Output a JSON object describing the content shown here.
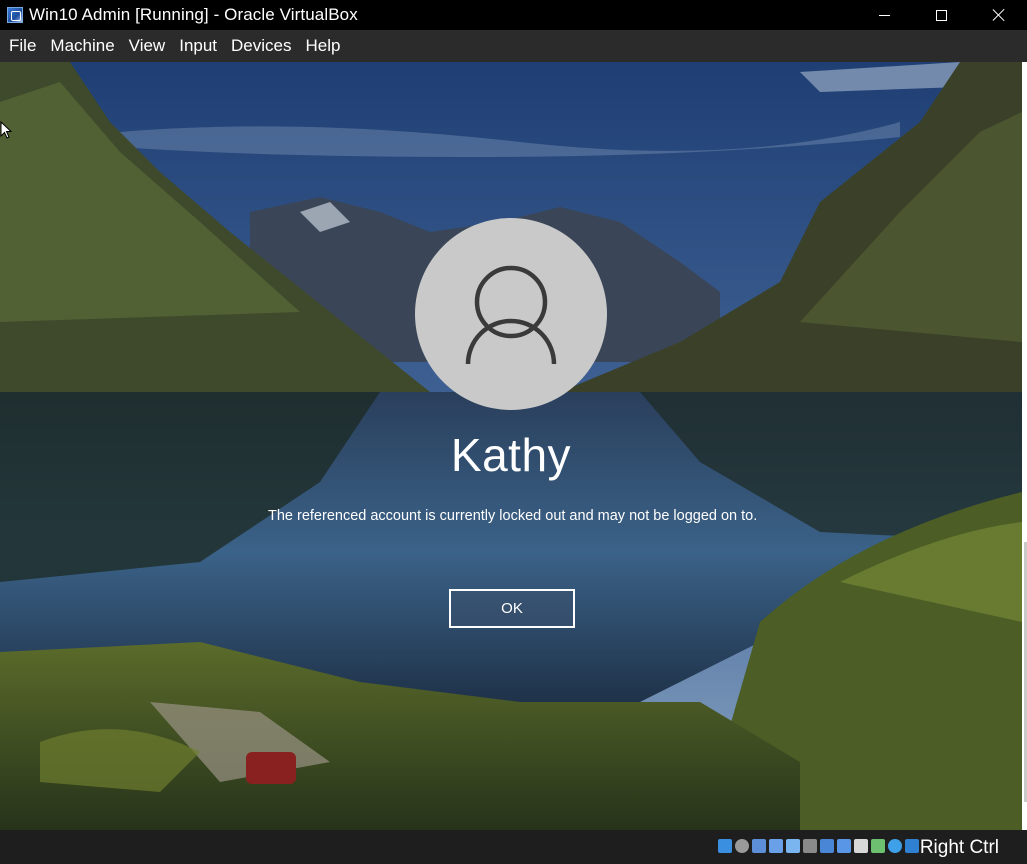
{
  "window": {
    "title": "Win10 Admin [Running] - Oracle VirtualBox",
    "minimize_icon": "minimize-icon",
    "maximize_icon": "maximize-icon",
    "close_icon": "close-icon"
  },
  "menubar": {
    "items": [
      "File",
      "Machine",
      "View",
      "Input",
      "Devices",
      "Help"
    ]
  },
  "lockscreen": {
    "username": "Kathy",
    "message": "The referenced account is currently locked out and may not be logged on to.",
    "ok_label": "OK",
    "avatar_icon": "user-avatar-icon"
  },
  "statusbar": {
    "host_key_label": "Right Ctrl",
    "icons": [
      "hard-disk-icon",
      "optical-drive-icon",
      "audio-icon",
      "network-icon",
      "usb-icon",
      "shared-folders-icon",
      "display-icon",
      "screen-capture-icon",
      "video-recording-icon",
      "virtualization-icon",
      "mouse-integration-icon",
      "keyboard-capture-icon"
    ],
    "icon_colors": [
      "#3b8fe0",
      "#9a9a9a",
      "#5c8fd8",
      "#6aa0e8",
      "#7ab5ef",
      "#8a8a8a",
      "#4a86d6",
      "#5a96e6",
      "#d8d8d8",
      "#6cc070",
      "#3ea0e8",
      "#2f80d0"
    ]
  },
  "colors": {
    "titlebar_bg": "#000000",
    "menubar_bg": "#2b2b2b",
    "avatar_bg": "#c9c9c9",
    "statusbar_bg": "#1e1e1e"
  }
}
